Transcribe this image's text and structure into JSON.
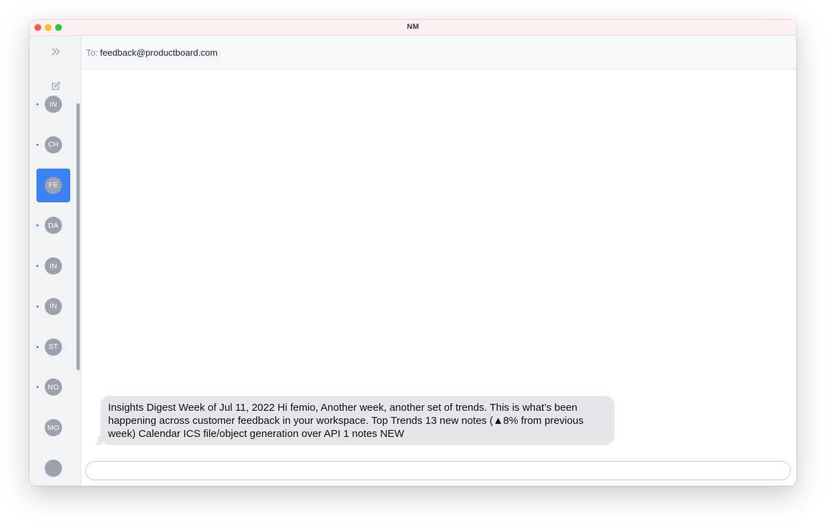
{
  "window": {
    "title": "NM"
  },
  "sidebar": {
    "expand_icon": "chevron-double-right-icon",
    "compose_icon": "compose-icon",
    "contacts": [
      {
        "initials": "IN",
        "unread": true,
        "selected": false
      },
      {
        "initials": "CH",
        "unread": true,
        "selected": false
      },
      {
        "initials": "FE",
        "unread": false,
        "selected": true
      },
      {
        "initials": "DA",
        "unread": true,
        "selected": false
      },
      {
        "initials": "IN",
        "unread": true,
        "selected": false
      },
      {
        "initials": "IN",
        "unread": true,
        "selected": false
      },
      {
        "initials": "ST",
        "unread": true,
        "selected": false
      },
      {
        "initials": "NO",
        "unread": true,
        "selected": false
      },
      {
        "initials": "MO",
        "unread": false,
        "selected": false
      },
      {
        "initials": "",
        "unread": false,
        "selected": false
      }
    ]
  },
  "header": {
    "to_label": "To:",
    "recipient": "feedback@productboard.com"
  },
  "messages": [
    {
      "text": "Insights Digest Week of Jul 11, 2022 Hi femio, Another week, another set of trends. This is what’s been happening across customer feedback in your workspace. Top Trends 13 new notes (▲8% from previous week) Calendar ICS file/object generation over API 1 notes NEW",
      "direction": "incoming"
    }
  ],
  "composer": {
    "value": "",
    "placeholder": ""
  },
  "colors": {
    "accent": "#3b82f6",
    "bubble_incoming": "#e5e5ea",
    "avatar": "#9ca1ad",
    "titlebar": "#fdf0f0"
  }
}
